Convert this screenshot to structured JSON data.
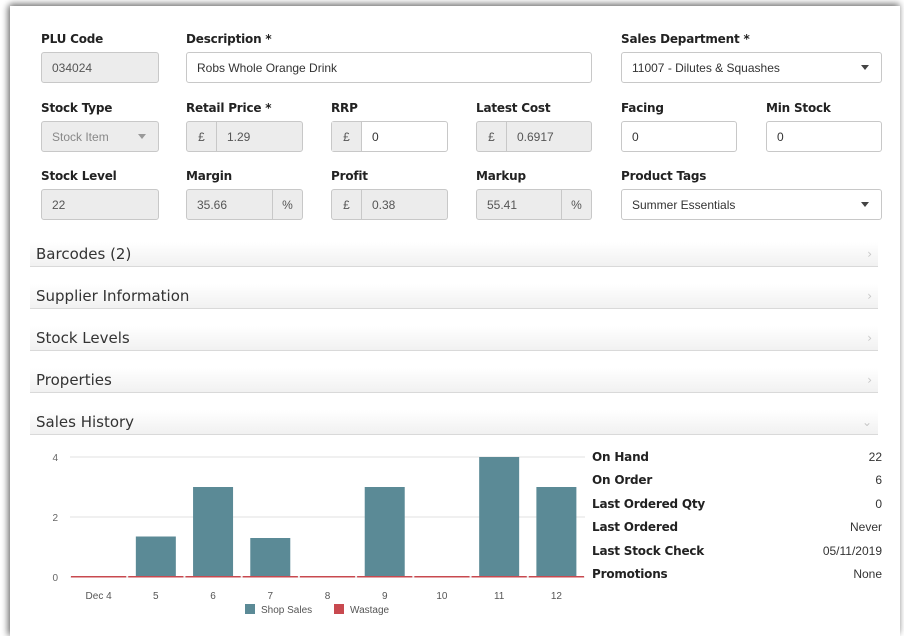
{
  "fields": {
    "plu_code": {
      "label": "PLU Code",
      "value": "034024"
    },
    "description": {
      "label": "Description *",
      "value": "Robs Whole Orange Drink"
    },
    "sales_department": {
      "label": "Sales Department *",
      "value": "11007 - Dilutes & Squashes"
    },
    "stock_type": {
      "label": "Stock Type",
      "value": "Stock Item"
    },
    "retail_price": {
      "label": "Retail Price *",
      "currency": "£",
      "value": "1.29"
    },
    "rrp": {
      "label": "RRP",
      "currency": "£",
      "value": "0"
    },
    "latest_cost": {
      "label": "Latest Cost",
      "currency": "£",
      "value": "0.6917"
    },
    "facing": {
      "label": "Facing",
      "value": "0"
    },
    "min_stock": {
      "label": "Min Stock",
      "value": "0"
    },
    "stock_level": {
      "label": "Stock Level",
      "value": "22"
    },
    "margin": {
      "label": "Margin",
      "value": "35.66",
      "unit": "%"
    },
    "profit": {
      "label": "Profit",
      "currency": "£",
      "value": "0.38"
    },
    "markup": {
      "label": "Markup",
      "value": "55.41",
      "unit": "%"
    },
    "product_tags": {
      "label": "Product Tags",
      "value": "Summer Essentials"
    }
  },
  "sections": [
    {
      "label": "Barcodes (2)",
      "chevron": "›"
    },
    {
      "label": "Supplier Information",
      "chevron": "›"
    },
    {
      "label": "Stock Levels",
      "chevron": "›"
    },
    {
      "label": "Properties",
      "chevron": "›"
    },
    {
      "label": "Sales History",
      "chevron": "⌄"
    }
  ],
  "stats": [
    {
      "label": "On Hand",
      "value": "22"
    },
    {
      "label": "On Order",
      "value": "6"
    },
    {
      "label": "Last Ordered Qty",
      "value": "0"
    },
    {
      "label": "Last Ordered",
      "value": "Never"
    },
    {
      "label": "Last Stock Check",
      "value": "05/11/2019"
    },
    {
      "label": "Promotions",
      "value": "None"
    }
  ],
  "chart_data": {
    "type": "bar",
    "categories": [
      "Dec 4",
      "5",
      "6",
      "7",
      "8",
      "9",
      "10",
      "11",
      "12"
    ],
    "series": [
      {
        "name": "Shop Sales",
        "color": "#5b8a96",
        "values": [
          0,
          1.35,
          3,
          1.3,
          0,
          3,
          0,
          4,
          3
        ]
      },
      {
        "name": "Wastage",
        "color": "#c8494f",
        "values": [
          0,
          0,
          0,
          0,
          0,
          0,
          0,
          0,
          0
        ]
      }
    ],
    "ylim": [
      0,
      4
    ],
    "yticks": [
      "0",
      "2",
      "4"
    ],
    "grid": true,
    "legend": "bottom-center"
  }
}
